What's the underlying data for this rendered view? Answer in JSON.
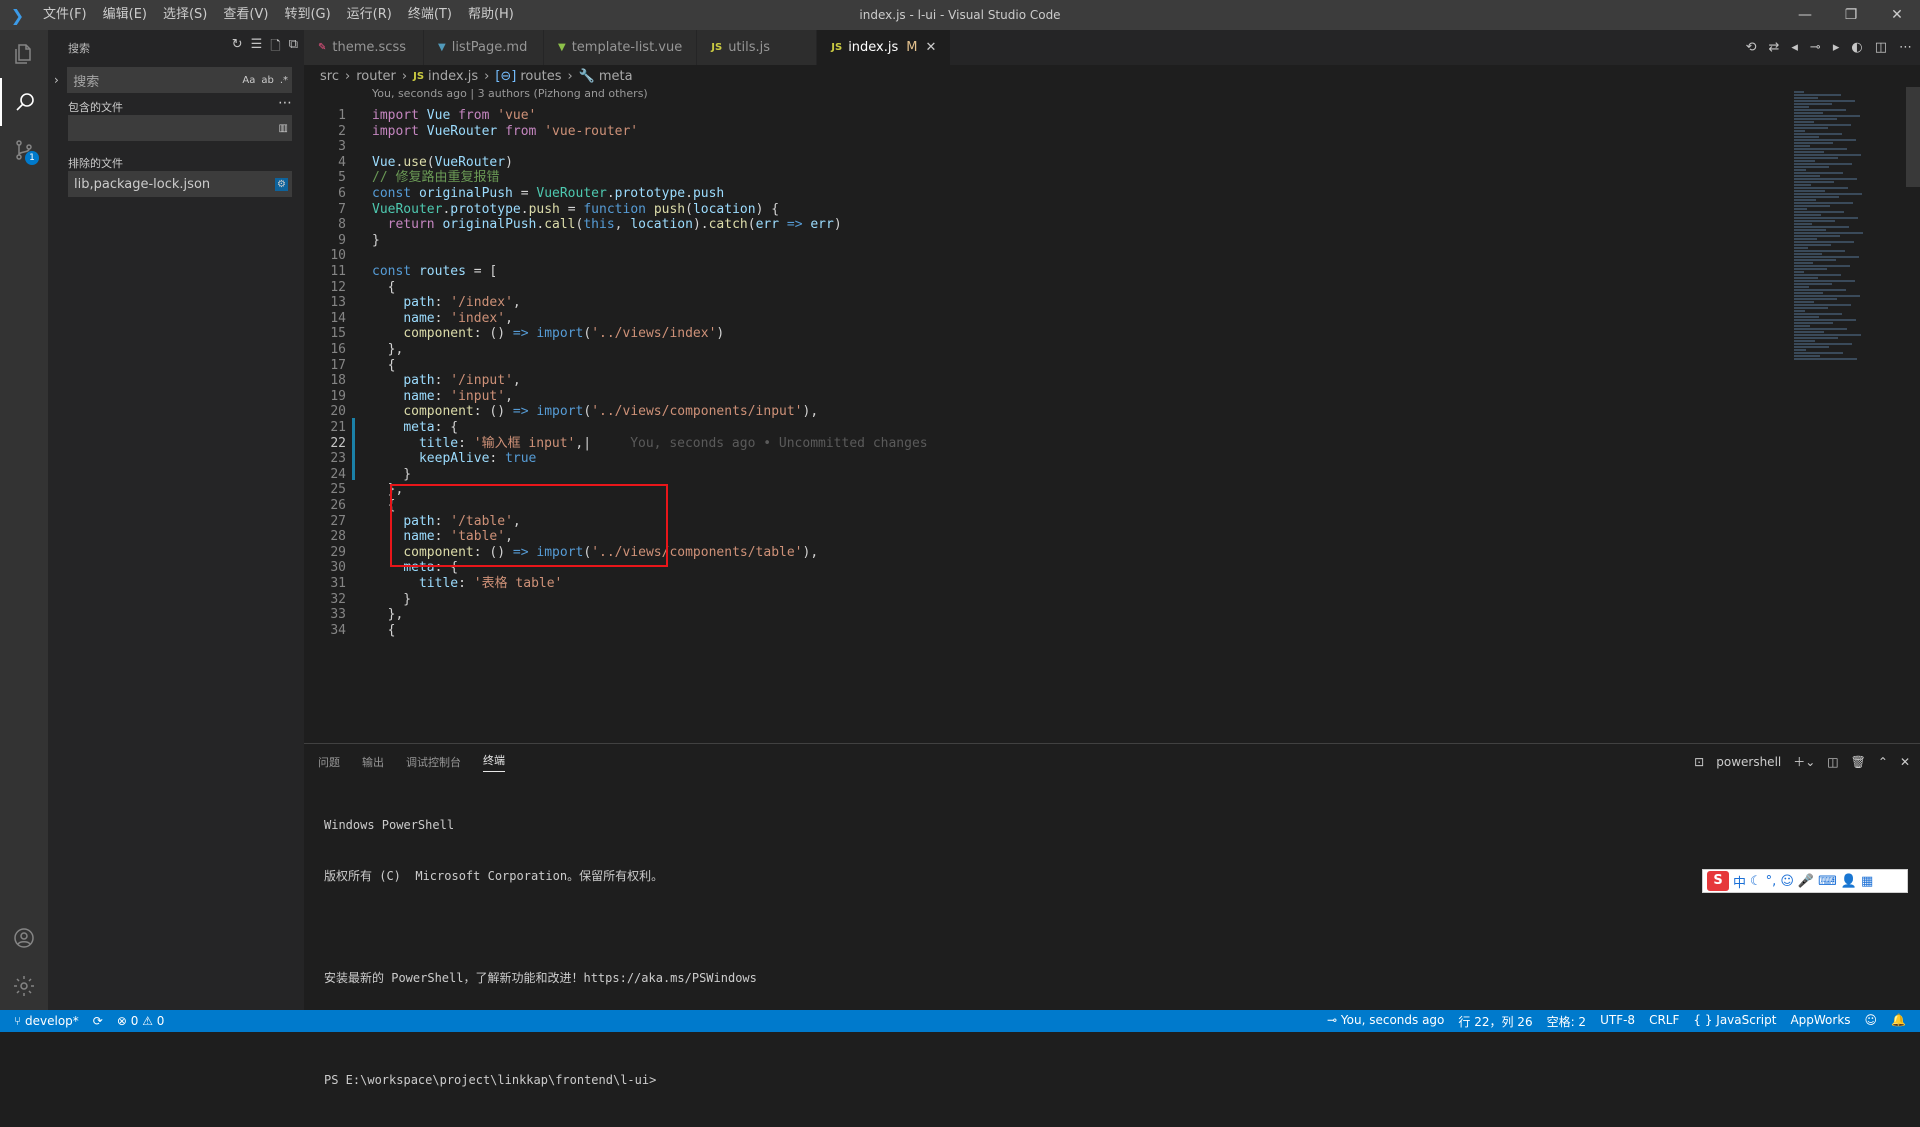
{
  "window": {
    "title": "index.js - l-ui - Visual Studio Code",
    "menu": [
      "文件(F)",
      "编辑(E)",
      "选择(S)",
      "查看(V)",
      "转到(G)",
      "运行(R)",
      "终端(T)",
      "帮助(H)"
    ]
  },
  "activity": {
    "scm_badge": "1"
  },
  "sidebar": {
    "title": "搜索",
    "search_placeholder": "搜索",
    "opt_case": "Aa",
    "opt_word": "ab",
    "opt_regex": ".*",
    "include_label": "包含的文件",
    "include_value": "",
    "exclude_label": "排除的文件",
    "exclude_value": "lib,package-lock.json"
  },
  "tabs": [
    {
      "label": "theme.scss",
      "icon": "scss-icon",
      "icon_color": "#f55385"
    },
    {
      "label": "listPage.md",
      "icon": "markdown-icon",
      "icon_color": "#519aba"
    },
    {
      "label": "template-list.vue",
      "icon": "vue-icon",
      "icon_color": "#8dc149"
    },
    {
      "label": "utils.js",
      "icon": "js-icon",
      "icon_color": "#cbcb41"
    },
    {
      "label": "index.js",
      "icon": "js-icon",
      "icon_color": "#cbcb41",
      "modified": "M"
    }
  ],
  "breadcrumb": [
    "src",
    "router",
    "index.js",
    "routes",
    "meta"
  ],
  "editor": {
    "codelens": "You, seconds ago | 3 authors (Pizhong and others)",
    "blame": "You, seconds ago • Uncommitted changes",
    "line_numbers": [
      "1",
      "2",
      "3",
      "4",
      "5",
      "6",
      "7",
      "8",
      "9",
      "10",
      "11",
      "12",
      "13",
      "14",
      "15",
      "16",
      "17",
      "18",
      "19",
      "20",
      "21",
      "22",
      "23",
      "24",
      "25",
      "26",
      "27",
      "28",
      "29",
      "30",
      "31",
      "32",
      "33",
      "34"
    ]
  },
  "panel": {
    "tabs": [
      "问题",
      "输出",
      "调试控制台",
      "终端"
    ],
    "active_tab": "终端",
    "shell": "powershell",
    "terminal_lines": [
      "Windows PowerShell",
      "版权所有 (C)  Microsoft Corporation。保留所有权利。",
      "",
      "安装最新的 PowerShell，了解新功能和改进！https://aka.ms/PSWindows",
      "",
      "PS E:\\workspace\\project\\linkkap\\frontend\\l-ui>"
    ]
  },
  "ime": {
    "label": "中"
  },
  "statusbar": {
    "branch": "develop*",
    "errors": "0",
    "warnings": "0",
    "blame": "You, seconds ago",
    "position": "行 22，列 26",
    "spaces": "空格: 2",
    "encoding": "UTF-8",
    "eol": "CRLF",
    "language": "JavaScript",
    "extension": "AppWorks"
  },
  "colors": {
    "accent": "#007acc",
    "highlight_box": "#e8161a"
  }
}
